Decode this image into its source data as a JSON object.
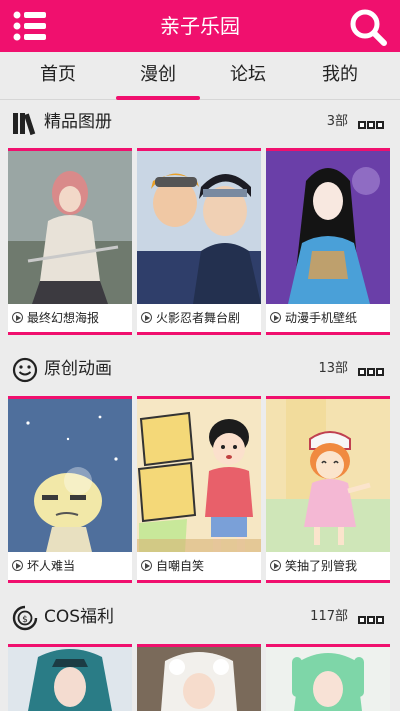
{
  "app": {
    "title": "亲子乐园"
  },
  "tabs": [
    {
      "label": "首页"
    },
    {
      "label": "漫创"
    },
    {
      "label": "论坛"
    },
    {
      "label": "我的"
    }
  ],
  "sections": [
    {
      "title": "精品图册",
      "count": "3部",
      "icon": "books-icon",
      "items": [
        {
          "caption": "最终幻想海报"
        },
        {
          "caption": "火影忍者舞台剧"
        },
        {
          "caption": "动漫手机壁纸"
        }
      ]
    },
    {
      "title": "原创动画",
      "count": "13部",
      "icon": "smiley-icon",
      "items": [
        {
          "caption": "坏人难当"
        },
        {
          "caption": "自嘲自笑"
        },
        {
          "caption": "笑抽了别管我"
        }
      ]
    },
    {
      "title": "COS福利",
      "count": "117部",
      "icon": "dollar-coin-icon",
      "items": []
    }
  ],
  "colors": {
    "accent": "#f0106e",
    "background": "#ececec"
  }
}
